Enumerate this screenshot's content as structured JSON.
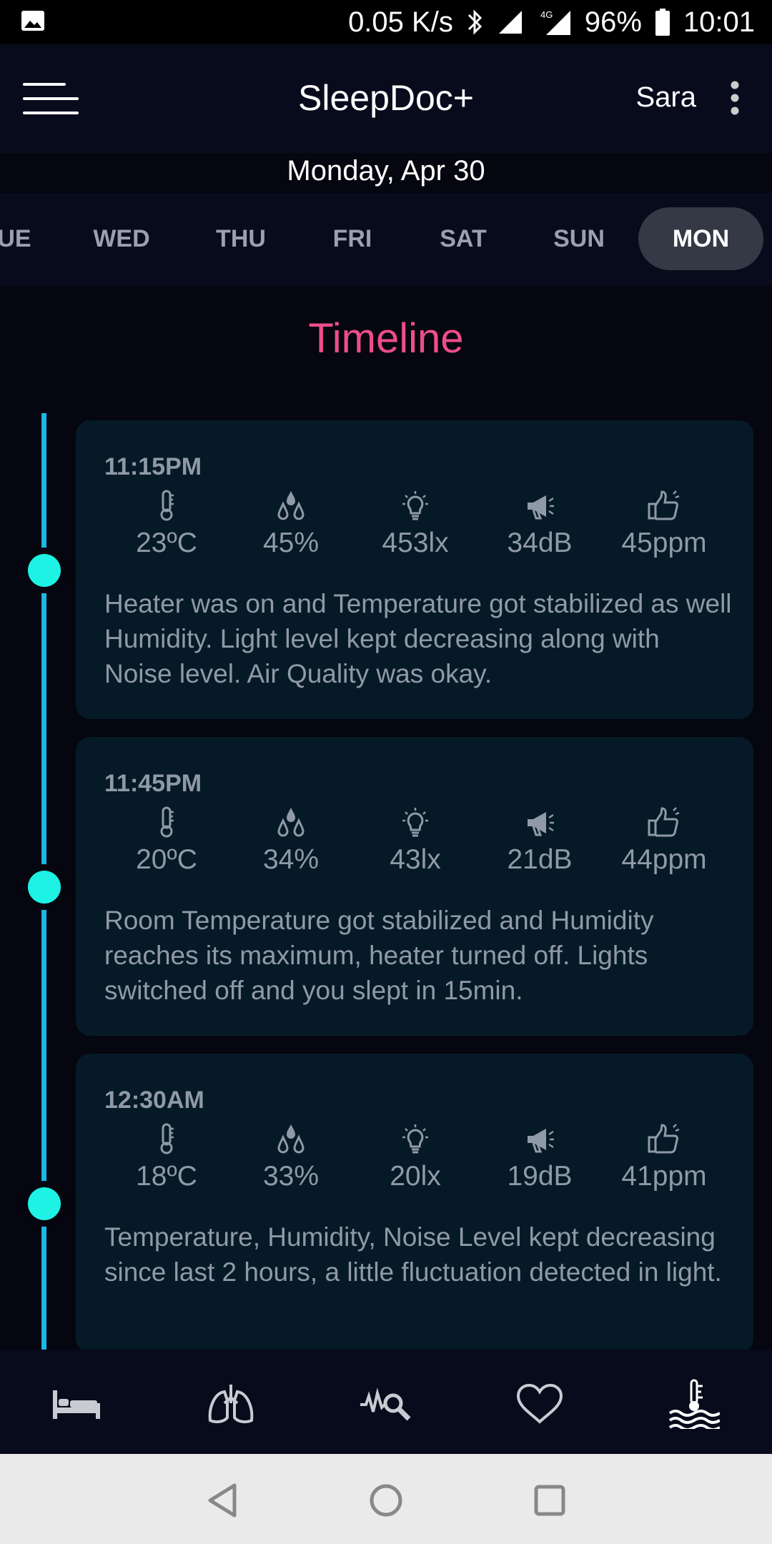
{
  "status_bar": {
    "speed": "0.05 K/s",
    "network": "4G",
    "battery": "96%",
    "time": "10:01",
    "icons": [
      "image-icon",
      "bluetooth-icon",
      "signal-icon",
      "signal-4g-icon",
      "battery-icon"
    ]
  },
  "app_bar": {
    "title": "SleepDoc+",
    "user": "Sara",
    "date": "Monday, Apr 30",
    "icons": [
      "menu-icon",
      "more-vert-icon"
    ]
  },
  "days": [
    {
      "label": "UE",
      "active": false
    },
    {
      "label": "WED",
      "active": false
    },
    {
      "label": "THU",
      "active": false
    },
    {
      "label": "FRI",
      "active": false
    },
    {
      "label": "SAT",
      "active": false
    },
    {
      "label": "SUN",
      "active": false
    },
    {
      "label": "MON",
      "active": true
    }
  ],
  "timeline": {
    "heading": "Timeline",
    "metric_icons": [
      "thermometer-icon",
      "humidity-drops-icon",
      "lightbulb-icon",
      "megaphone-icon",
      "thumbs-up-icon"
    ],
    "entries": [
      {
        "time": "11:15PM",
        "temperature": "23ºC",
        "humidity": "45%",
        "light": "453lx",
        "noise": "34dB",
        "air": "45ppm",
        "description": "Heater was on and Temperature got stabilized as well Humidity. Light level kept decreasing along with Noise level. Air Quality was okay."
      },
      {
        "time": "11:45PM",
        "temperature": "20ºC",
        "humidity": "34%",
        "light": "43lx",
        "noise": "21dB",
        "air": "44ppm",
        "description": "Room Temperature got stabilized and Humid­ity reaches its maximum, heater turned off. Lights switched off and you slept in 15min."
      },
      {
        "time": "12:30AM",
        "temperature": "18ºC",
        "humidity": "33%",
        "light": "20lx",
        "noise": "19dB",
        "air": "41ppm",
        "description": "Temperature, Humidity, Noise Level kept decreasing since last 2 hours, a little fluctuation detected in light."
      }
    ]
  },
  "bottom_nav": {
    "items": [
      "bed-icon",
      "lungs-icon",
      "wave-search-icon",
      "heart-icon",
      "thermometer-water-icon"
    ],
    "active_index": 4
  },
  "system_nav": {
    "items": [
      "back-icon",
      "home-icon",
      "recents-icon"
    ]
  },
  "colors": {
    "background": "#05060f",
    "card": "#051a26",
    "accent_pink": "#ee4e88",
    "timeline_line": "#1bb9e6",
    "timeline_dot": "#1df2e4",
    "muted_text": "#8f9aa6"
  }
}
